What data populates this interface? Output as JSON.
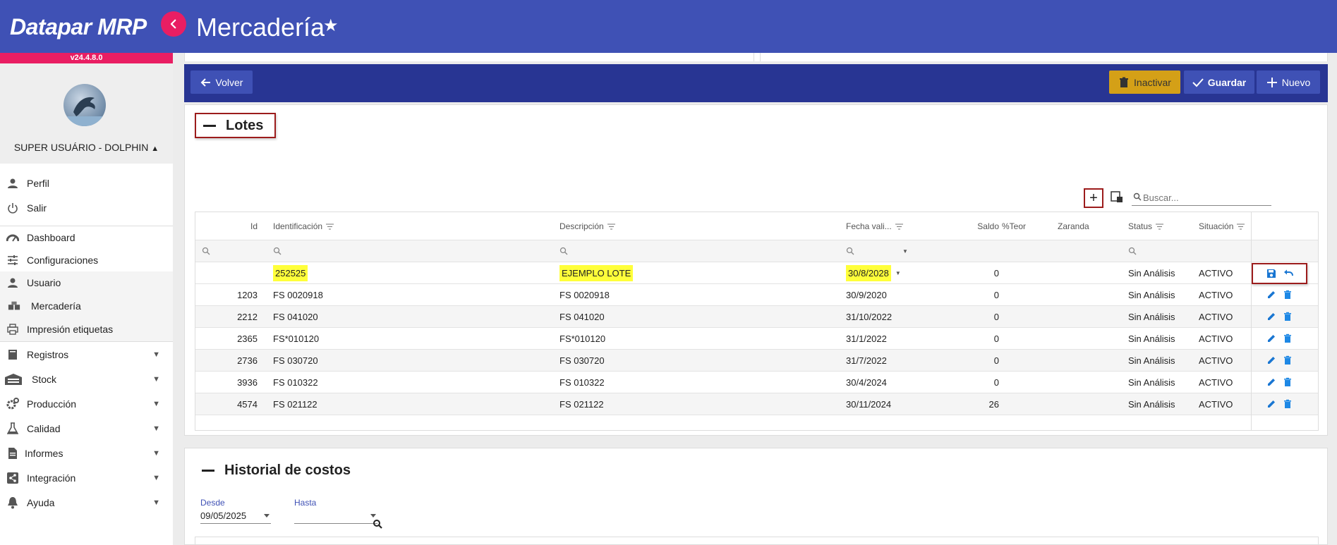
{
  "app": {
    "brand": "Datapar MRP",
    "version": "v24.4.8.0",
    "page_title": "Mercadería",
    "colors": {
      "primary": "#3f51b5",
      "dark_primary": "#283593",
      "accent": "#e91e63",
      "warning": "#d4a017",
      "highlight": "#ffff3a"
    }
  },
  "user": {
    "name": "SUPER USUÁRIO - DOLPHIN"
  },
  "sidebar": {
    "account": [
      {
        "label": "Perfil",
        "icon": "person-icon"
      },
      {
        "label": "Salir",
        "icon": "power-icon"
      }
    ],
    "items": [
      {
        "label": "Dashboard",
        "icon": "dashboard-icon"
      },
      {
        "label": "Configuraciones",
        "icon": "sliders-icon"
      },
      {
        "label": "Usuario",
        "icon": "person-icon"
      },
      {
        "label": "Mercadería",
        "icon": "boxes-icon"
      },
      {
        "label": "Impresión etiquetas",
        "icon": "printer-icon"
      },
      {
        "label": "Registros",
        "icon": "book-icon"
      },
      {
        "label": "Stock",
        "icon": "warehouse-icon"
      },
      {
        "label": "Producción",
        "icon": "gears-icon"
      },
      {
        "label": "Calidad",
        "icon": "flask-icon"
      },
      {
        "label": "Informes",
        "icon": "document-icon"
      },
      {
        "label": "Integración",
        "icon": "share-icon"
      },
      {
        "label": "Ayuda",
        "icon": "bell-icon"
      }
    ]
  },
  "toolbar": {
    "back_label": "Volver",
    "inactivate_label": "Inactivar",
    "save_label": "Guardar",
    "new_label": "Nuevo"
  },
  "lotes": {
    "title": "Lotes",
    "search_placeholder": "Buscar...",
    "columns": {
      "id": "Id",
      "identificacion": "Identificación",
      "descripcion": "Descripción",
      "fecha": "Fecha vali...",
      "saldo": "Saldo",
      "teor": "%Teor",
      "zaranda": "Zaranda",
      "status": "Status",
      "situacion": "Situación"
    },
    "editing_row": {
      "id": "",
      "identificacion": "252525",
      "descripcion": "EJEMPLO LOTE",
      "fecha": "30/8/2028",
      "saldo": "0",
      "status": "Sin Análisis",
      "situacion": "ACTIVO"
    },
    "rows": [
      {
        "id": "1203",
        "identificacion": "FS 0020918",
        "descripcion": "FS 0020918",
        "fecha": "30/9/2020",
        "saldo": "0",
        "status": "Sin Análisis",
        "situacion": "ACTIVO"
      },
      {
        "id": "2212",
        "identificacion": "FS 041020",
        "descripcion": "FS 041020",
        "fecha": "31/10/2022",
        "saldo": "0",
        "status": "Sin Análisis",
        "situacion": "ACTIVO"
      },
      {
        "id": "2365",
        "identificacion": "FS*010120",
        "descripcion": "FS*010120",
        "fecha": "31/1/2022",
        "saldo": "0",
        "status": "Sin Análisis",
        "situacion": "ACTIVO"
      },
      {
        "id": "2736",
        "identificacion": "FS 030720",
        "descripcion": "FS 030720",
        "fecha": "31/7/2022",
        "saldo": "0",
        "status": "Sin Análisis",
        "situacion": "ACTIVO"
      },
      {
        "id": "3936",
        "identificacion": "FS 010322",
        "descripcion": "FS 010322",
        "fecha": "30/4/2024",
        "saldo": "0",
        "status": "Sin Análisis",
        "situacion": "ACTIVO"
      },
      {
        "id": "4574",
        "identificacion": "FS 021122",
        "descripcion": "FS 021122",
        "fecha": "30/11/2024",
        "saldo": "26",
        "status": "Sin Análisis",
        "situacion": "ACTIVO"
      }
    ]
  },
  "historial": {
    "title": "Historial de costos",
    "desde_label": "Desde",
    "desde_value": "09/05/2025",
    "hasta_label": "Hasta",
    "hasta_value": ""
  }
}
